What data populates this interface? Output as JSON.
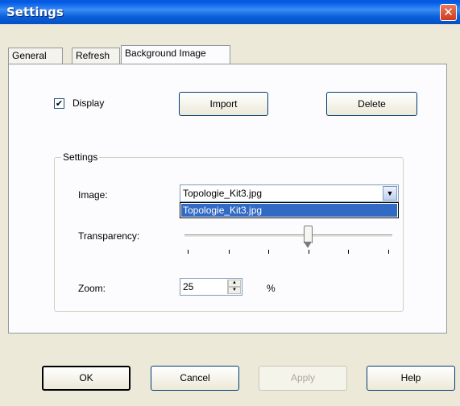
{
  "window": {
    "title": "Settings",
    "close_glyph": "✕"
  },
  "tabs": [
    {
      "label": "General"
    },
    {
      "label": "Refresh"
    },
    {
      "label": "Background Image",
      "active": true
    }
  ],
  "background_image": {
    "display_label": "Display",
    "display_checked": true,
    "import_label": "Import",
    "delete_label": "Delete",
    "group_label": "Settings",
    "image_label": "Image:",
    "image_value": "Topologie_Kit3.jpg",
    "image_options": [
      "Topologie_Kit3.jpg"
    ],
    "transparency_label": "Transparency:",
    "transparency_level": 0.6,
    "zoom_label": "Zoom:",
    "zoom_value": "25",
    "zoom_unit": "%"
  },
  "footer": {
    "ok_label": "OK",
    "cancel_label": "Cancel",
    "apply_label": "Apply",
    "help_label": "Help"
  },
  "icons": {
    "check": "✔",
    "dropdown": "▼",
    "up": "▲",
    "down": "▼"
  },
  "colors": {
    "titlebar": "#0a5fd8",
    "selection": "#316ac5",
    "face": "#ece9d8"
  }
}
